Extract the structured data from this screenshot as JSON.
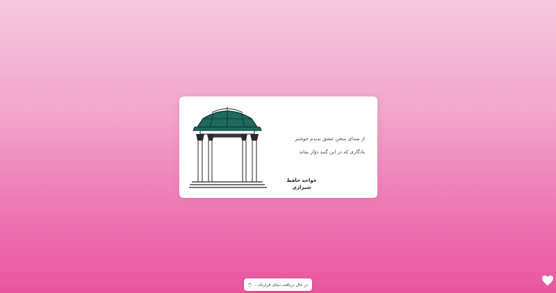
{
  "card": {
    "verses": [
      "از صدای سخن عشق ندیدم خوشتر",
      "یادگاری که در این گنبد دوّار بماند"
    ],
    "poet": "خواجه حافظ شیرازی"
  },
  "loading": {
    "text": "در حال دریافت دیتای قرارداد..."
  },
  "icons": {
    "illustration": "hafez-tomb-illustration",
    "favorite": "heart-icon",
    "loading": "spinner-icon"
  },
  "colors": {
    "dome": "#1e6b5c",
    "heart": "#ffffff"
  }
}
